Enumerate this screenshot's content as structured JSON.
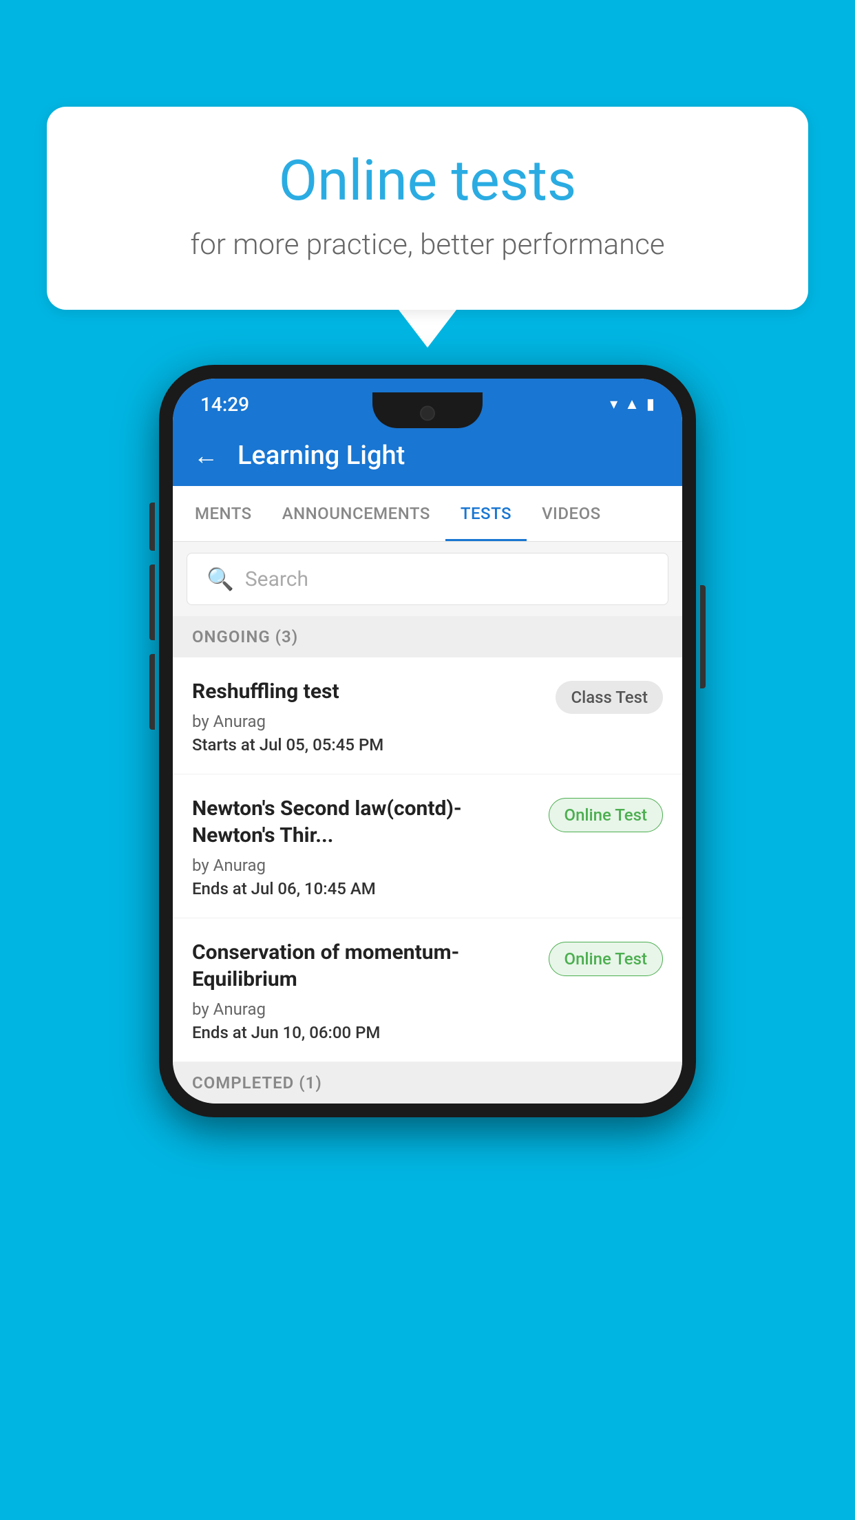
{
  "background_color": "#00B5E2",
  "speech_bubble": {
    "title": "Online tests",
    "subtitle": "for more practice, better performance"
  },
  "phone": {
    "status_bar": {
      "time": "14:29",
      "wifi_icon": "▼",
      "signal_icon": "▲",
      "battery_icon": "▮"
    },
    "app_header": {
      "back_label": "←",
      "title": "Learning Light"
    },
    "tabs": [
      {
        "label": "MENTS",
        "active": false
      },
      {
        "label": "ANNOUNCEMENTS",
        "active": false
      },
      {
        "label": "TESTS",
        "active": true
      },
      {
        "label": "VIDEOS",
        "active": false
      }
    ],
    "search": {
      "placeholder": "Search"
    },
    "ongoing_section": {
      "label": "ONGOING (3)"
    },
    "tests": [
      {
        "name": "Reshuffling test",
        "author": "by Anurag",
        "date_label": "Starts at",
        "date_value": "Jul 05, 05:45 PM",
        "badge": "Class Test",
        "badge_type": "class"
      },
      {
        "name": "Newton's Second law(contd)-Newton's Thir...",
        "author": "by Anurag",
        "date_label": "Ends at",
        "date_value": "Jul 06, 10:45 AM",
        "badge": "Online Test",
        "badge_type": "online"
      },
      {
        "name": "Conservation of momentum-Equilibrium",
        "author": "by Anurag",
        "date_label": "Ends at",
        "date_value": "Jun 10, 06:00 PM",
        "badge": "Online Test",
        "badge_type": "online"
      }
    ],
    "completed_section": {
      "label": "COMPLETED (1)"
    }
  }
}
